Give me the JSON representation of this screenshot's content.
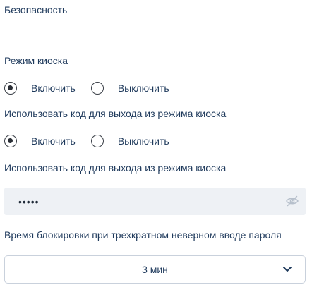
{
  "section": {
    "title": "Безопасность"
  },
  "kiosk_mode": {
    "label": "Режим киоска",
    "options": [
      {
        "label": "Включить",
        "checked": true
      },
      {
        "label": "Выключить",
        "checked": false
      }
    ]
  },
  "exit_code": {
    "label": "Использовать код для выхода из режима киоска",
    "options": [
      {
        "label": "Включить",
        "checked": true
      },
      {
        "label": "Выключить",
        "checked": false
      }
    ]
  },
  "exit_code_password": {
    "label": "Использовать код для выхода из режима киоска",
    "value": "•••••",
    "toggle_icon": "eye-slash-icon"
  },
  "lock_time": {
    "label": "Время блокировки при трехкратном неверном вводе пароля",
    "value": "3 мин",
    "dropdown_icon": "chevron-down-icon"
  }
}
